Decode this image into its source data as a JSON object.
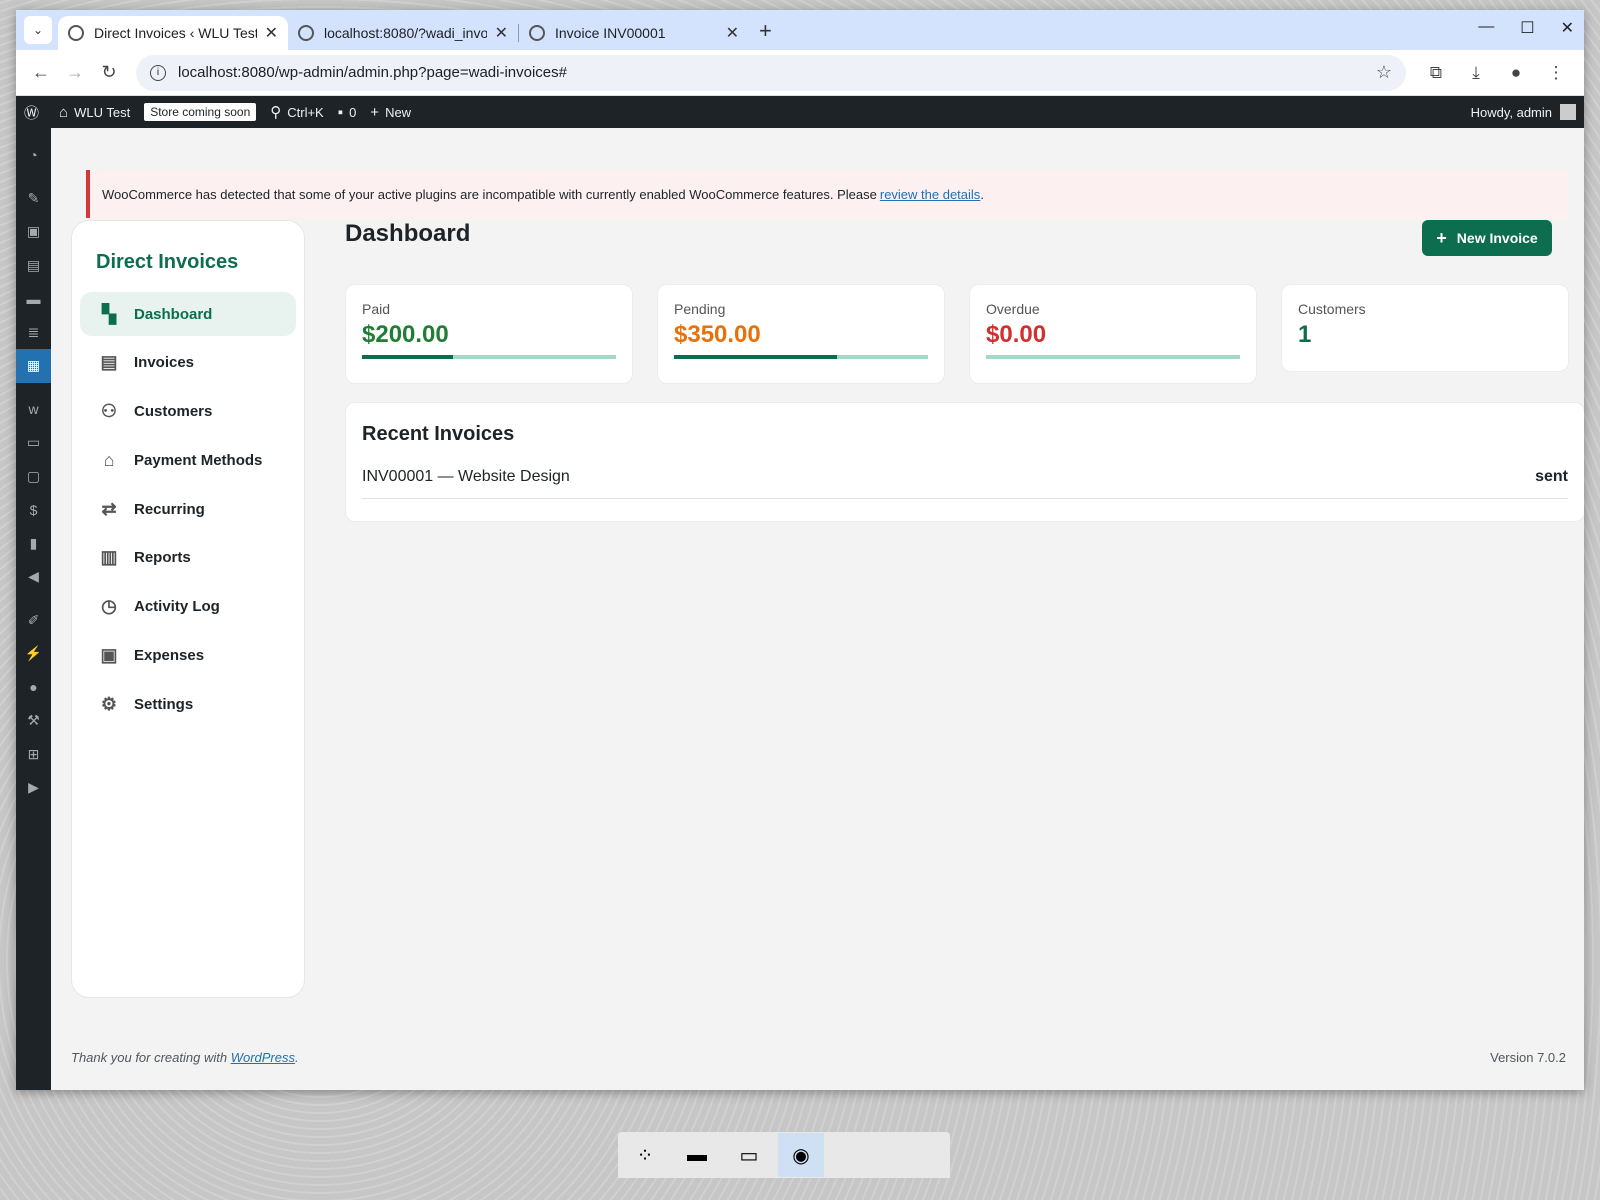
{
  "browser": {
    "tabs": [
      {
        "title": "Direct Invoices ‹ WLU Test",
        "active": true
      },
      {
        "title": "localhost:8080/?wadi_invo",
        "active": false
      },
      {
        "title": "Invoice INV00001",
        "active": false
      }
    ],
    "url": "localhost:8080/wp-admin/admin.php?page=wadi-invoices#"
  },
  "adminbar": {
    "site_name": "WLU Test",
    "store_badge": "Store coming soon",
    "search_shortcut": "Ctrl+K",
    "comments_count": "0",
    "new_label": "New",
    "howdy": "Howdy, admin"
  },
  "notice": {
    "text": "WooCommerce has detected that some of your active plugins are incompatible with currently enabled WooCommerce features. Please",
    "link_text": "review the details",
    "suffix": "."
  },
  "sidebar": {
    "brand": "Direct Invoices",
    "items": [
      {
        "label": "Dashboard",
        "icon": "dashboard-icon",
        "active": true
      },
      {
        "label": "Invoices",
        "icon": "invoice-icon"
      },
      {
        "label": "Customers",
        "icon": "people-icon"
      },
      {
        "label": "Payment Methods",
        "icon": "bank-icon"
      },
      {
        "label": "Recurring",
        "icon": "repeat-icon"
      },
      {
        "label": "Reports",
        "icon": "bar-chart-icon"
      },
      {
        "label": "Activity Log",
        "icon": "history-icon"
      },
      {
        "label": "Expenses",
        "icon": "wallet-icon"
      },
      {
        "label": "Settings",
        "icon": "gear-icon"
      }
    ]
  },
  "main": {
    "title": "Dashboard",
    "new_invoice_label": "New Invoice",
    "stats": [
      {
        "label": "Paid",
        "value": "$200.00",
        "color": "#1e7e34",
        "progress": 0.36
      },
      {
        "label": "Pending",
        "value": "$350.00",
        "color": "#e8710a",
        "progress": 0.64
      },
      {
        "label": "Overdue",
        "value": "$0.00",
        "color": "#d32f2f",
        "progress": 0
      },
      {
        "label": "Customers",
        "value": "1",
        "color": "#0d6e4f"
      }
    ],
    "recent": {
      "title": "Recent Invoices",
      "rows": [
        {
          "text": "INV00001 — Website Design",
          "status": "sent"
        }
      ]
    }
  },
  "footer": {
    "thanks": "Thank you for creating with",
    "link": "WordPress",
    "suffix": ".",
    "version": "Version 7.0.2"
  },
  "colors": {
    "accent": "#0d6e4f",
    "wp_dark": "#1d2327",
    "wp_blue": "#2271b1"
  }
}
